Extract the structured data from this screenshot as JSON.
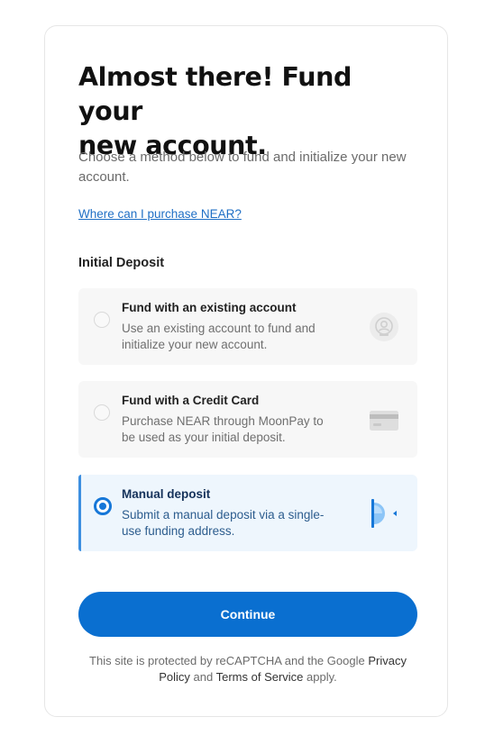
{
  "heading": {
    "title_line1": "Almost there! Fund your",
    "title_line2": "new account.",
    "subtitle": "Choose a method below to fund and initialize your new account.",
    "purchase_link": "Where can I purchase NEAR?"
  },
  "deposit": {
    "section_label": "Initial Deposit",
    "options": [
      {
        "title": "Fund with an existing account",
        "description": "Use an existing account to fund and initialize your new account.",
        "icon": "account-icon",
        "selected": false
      },
      {
        "title": "Fund with a Credit Card",
        "description": "Purchase NEAR through MoonPay to be used as your initial deposit.",
        "icon": "credit-card-icon",
        "selected": false
      },
      {
        "title": "Manual deposit",
        "description": "Submit a manual deposit via a single-use funding address.",
        "icon": "manual-deposit-icon",
        "selected": true
      }
    ]
  },
  "actions": {
    "continue_label": "Continue"
  },
  "legal": {
    "prefix": "This site is protected by reCAPTCHA and the Google",
    "privacy_link": "Privacy Policy",
    "and_text": "and",
    "terms_link": "Terms of Service",
    "suffix": "apply."
  },
  "colors": {
    "accent": "#0a6fd0",
    "selected_bg": "#eef6fd",
    "selected_border": "#3d8fe0",
    "option_bg": "#f7f7f7"
  }
}
